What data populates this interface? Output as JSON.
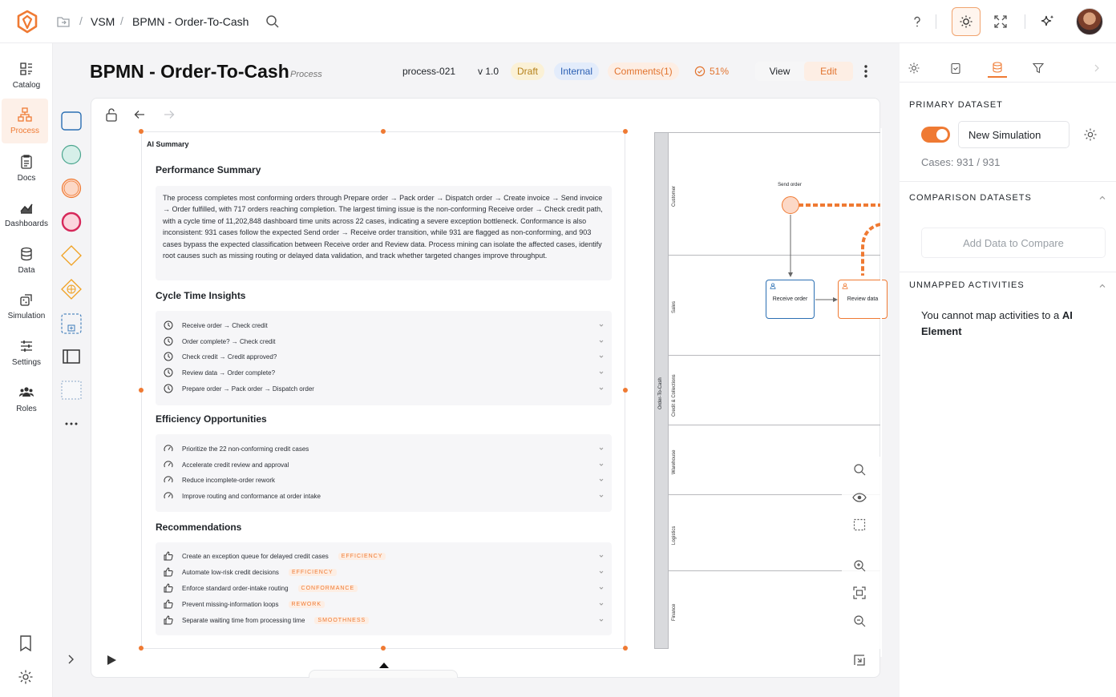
{
  "breadcrumb": {
    "root": "VSM",
    "current": "BPMN - Order-To-Cash"
  },
  "sidebar": {
    "items": [
      {
        "label": "Catalog",
        "icon": "catalog-icon"
      },
      {
        "label": "Process",
        "icon": "process-icon"
      },
      {
        "label": "Docs",
        "icon": "docs-icon"
      },
      {
        "label": "Dashboards",
        "icon": "dashboards-icon"
      },
      {
        "label": "Data",
        "icon": "data-icon"
      },
      {
        "label": "Simulation",
        "icon": "simulation-icon"
      },
      {
        "label": "Settings",
        "icon": "settings-icon"
      },
      {
        "label": "Roles",
        "icon": "roles-icon"
      }
    ],
    "active": "Process"
  },
  "header": {
    "title": "BPMN - Order-To-Cash",
    "type": "Process",
    "id": "process-021",
    "version": "v 1.0",
    "status": "Draft",
    "visibility": "Internal",
    "comments": "Comments(1)",
    "progress": "51%",
    "view_label": "View",
    "edit_label": "Edit"
  },
  "summary": {
    "label": "AI Summary",
    "performance": {
      "heading": "Performance Summary",
      "text": "The process completes most conforming orders through Prepare order → Pack order → Dispatch order → Create invoice → Send invoice → Order fulfilled, with 717 orders reaching completion. The largest timing issue is the non-conforming Receive order → Check credit path, with a cycle time of 11,202,848 dashboard time units across 22 cases, indicating a severe exception bottleneck. Conformance is also inconsistent: 931 cases follow the expected Send order → Receive order transition, while 931 are flagged as non-conforming, and 903 cases bypass the expected classification between Receive order and Review data. Process mining can isolate the affected cases, identify root causes such as missing routing or delayed data validation, and track whether targeted changes improve throughput."
    },
    "cycle": {
      "heading": "Cycle Time Insights",
      "items": [
        "Receive order → Check credit",
        "Order complete? → Check credit",
        "Check credit → Credit approved?",
        "Review data → Order complete?",
        "Prepare order → Pack order → Dispatch order"
      ]
    },
    "efficiency": {
      "heading": "Efficiency Opportunities",
      "items": [
        "Prioritize the 22 non-conforming credit cases",
        "Accelerate credit review and approval",
        "Reduce incomplete-order rework",
        "Improve routing and conformance at order intake"
      ]
    },
    "recommendations": {
      "heading": "Recommendations",
      "items": [
        {
          "text": "Create an exception queue for delayed credit cases",
          "tag": "EFFICIENCY"
        },
        {
          "text": "Automate low-risk credit decisions",
          "tag": "EFFICIENCY"
        },
        {
          "text": "Enforce standard order-intake routing",
          "tag": "CONFORMANCE"
        },
        {
          "text": "Prevent missing-information loops",
          "tag": "REWORK"
        },
        {
          "text": "Separate waiting time from processing time",
          "tag": "SMOOTHNESS"
        }
      ]
    }
  },
  "diagram": {
    "pool": "Order-To-Cash",
    "lanes": [
      "Customer",
      "Sales",
      "Credit & Collections",
      "Warehouse",
      "Logistics",
      "Finance"
    ],
    "event": "Send order",
    "tasks": [
      "Receive order",
      "Review data"
    ]
  },
  "right_panel": {
    "primary_heading": "PRIMARY DATASET",
    "simulation_name": "New Simulation",
    "cases_label": "Cases:",
    "cases_value": "931 / 931",
    "comparison_heading": "COMPARISON DATASETS",
    "add_compare": "Add Data to Compare",
    "unmapped_heading": "UNMAPPED ACTIVITIES",
    "unmapped_text_1": "You cannot map activities to a ",
    "unmapped_text_bold": "AI Element"
  },
  "colors": {
    "accent": "#ef7a33",
    "draft": "#b5811b",
    "internal": "#2b5fb3"
  }
}
